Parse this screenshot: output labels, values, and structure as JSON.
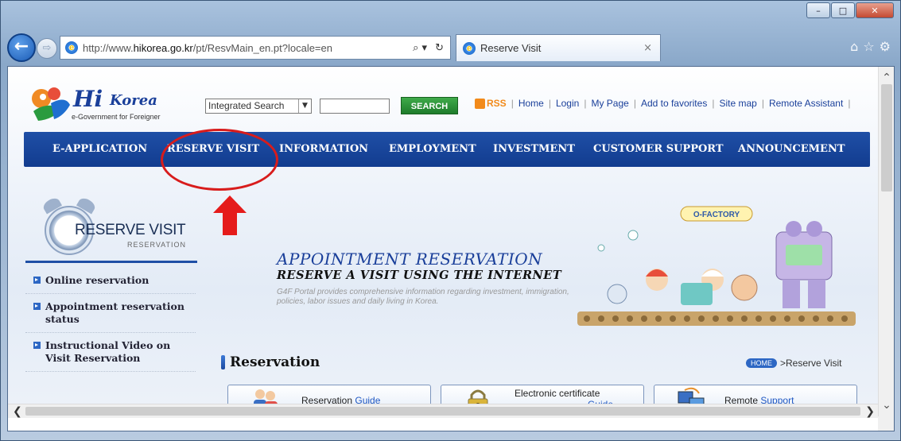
{
  "browser": {
    "url_prefix": "http://www.",
    "url_domain": "hikorea.go.kr",
    "url_path": "/pt/ResvMain_en.pt?locale=en",
    "tab_title": "Reserve Visit"
  },
  "header": {
    "logo_hi": "Hi",
    "logo_korea": "Korea",
    "logo_tagline": "e-Government for Foreigner",
    "search_select": "Integrated Search",
    "search_input": "",
    "search_button": "SEARCH",
    "links": [
      "RSS",
      "Home",
      "Login",
      "My Page",
      "Add to favorites",
      "Site map",
      "Remote Assistant"
    ]
  },
  "nav": {
    "items": [
      "E-APPLICATION",
      "RESERVE VISIT",
      "INFORMATION",
      "EMPLOYMENT",
      "INVESTMENT",
      "CUSTOMER SUPPORT",
      "ANNOUNCEMENT"
    ]
  },
  "sidebar": {
    "title": "RESERVE VISIT",
    "subtitle": "RESERVATION",
    "items": [
      "Online reservation",
      "Appointment reservation status",
      "Instructional Video on Visit Reservation"
    ]
  },
  "banner": {
    "title": "APPOINTMENT RESERVATION",
    "subtitle": "RESERVE A VISIT USING THE INTERNET",
    "description": "G4F Portal provides comprehensive information regarding investment, immigration, policies, labor issues and daily living in Korea.",
    "illustration_label": "O-FACTORY"
  },
  "section": {
    "title": "Reservation",
    "breadcrumb_home": "HOME",
    "breadcrumb_current": ">Reserve Visit"
  },
  "quick_buttons": [
    {
      "label": "Reservation",
      "label_blue": "Guide"
    },
    {
      "label": "Electronic certificate",
      "label_blue": "Guide"
    },
    {
      "label": "Remote",
      "label_blue": "Support"
    }
  ],
  "colors": {
    "nav_blue": "#1a4699",
    "accent_red": "#d81c1c",
    "search_green": "#2a9137"
  }
}
